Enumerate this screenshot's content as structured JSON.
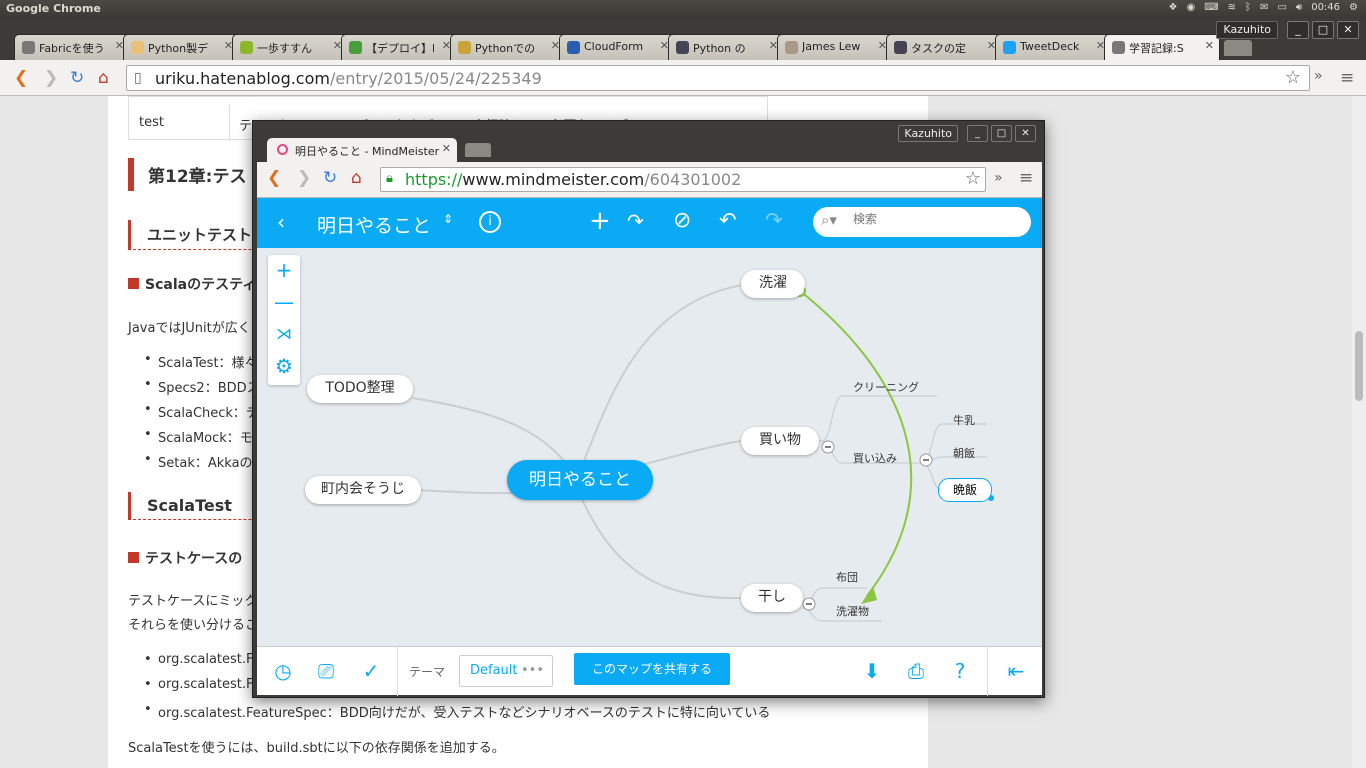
{
  "system": {
    "app_name": "Google Chrome",
    "user": "Kazuhito",
    "time": "00:46"
  },
  "browser": {
    "tabs": [
      {
        "label": "Fabricを使う"
      },
      {
        "label": "Python製デ"
      },
      {
        "label": "一歩すすん"
      },
      {
        "label": "【デプロイ】F"
      },
      {
        "label": "Pythonでの"
      },
      {
        "label": "CloudForm"
      },
      {
        "label": "Python の"
      },
      {
        "label": "James Lew"
      },
      {
        "label": "タスクの定"
      },
      {
        "label": "TweetDeck"
      },
      {
        "label": "学習記録:S"
      }
    ],
    "url_host": "uriku.hatenablog.com",
    "url_path": "/entry/2015/05/24/225349"
  },
  "article": {
    "table_c1": "test",
    "table_c2": "テストケースのコンパイルおよびテスト実行時にのみ必要なライブラリ",
    "h2_1": "第12章:テス",
    "h3_1": "ユニットテスト",
    "h4_1": "Scalaのテスティ",
    "p1": "JavaではJUnitが広く",
    "list1": [
      "ScalaTest：様々",
      "Specs2：BDDス",
      "ScalaCheck：デ",
      "ScalaMock：モ",
      "Setak：Akkaの"
    ],
    "h3_2": "ScalaTest",
    "h4_2": "テストケースの",
    "p2a": "テストケースにミック",
    "p2b": "それらを使い分けるこ",
    "list2": [
      "org.scalatest.F",
      "org.scalatest.F",
      "org.scalatest.FeatureSpec：BDD向けだが、受入テストなどシナリオベースのテストに特に向いている"
    ],
    "p3": "ScalaTestを使うには、build.sbtに以下の依存関係を追加する。"
  },
  "mm": {
    "tab_title": "明日やること - MindMeister",
    "url_scheme": "https://",
    "url_host": "www.mindmeister.com",
    "url_path": "/604301002",
    "map_title": "明日やること",
    "search_placeholder": "検索",
    "nodes": {
      "root": "明日やること",
      "sentaku": "洗濯",
      "todo": "TODO整理",
      "chounai": "町内会そうじ",
      "kaimono": "買い物",
      "hoshi": "干し",
      "cleaning": "クリーニング",
      "kaikomi": "買い込み",
      "gyunyu": "牛乳",
      "asameshi": "朝飯",
      "banmeshi": "晩飯",
      "futon": "布団",
      "sentakumono": "洗濯物"
    },
    "footer": {
      "theme_label": "テーマ",
      "theme_value": "Default",
      "share_label": "このマップを共有する"
    },
    "colors": {
      "accent": "#0aaaf4",
      "connector": "#8cc63f"
    }
  }
}
